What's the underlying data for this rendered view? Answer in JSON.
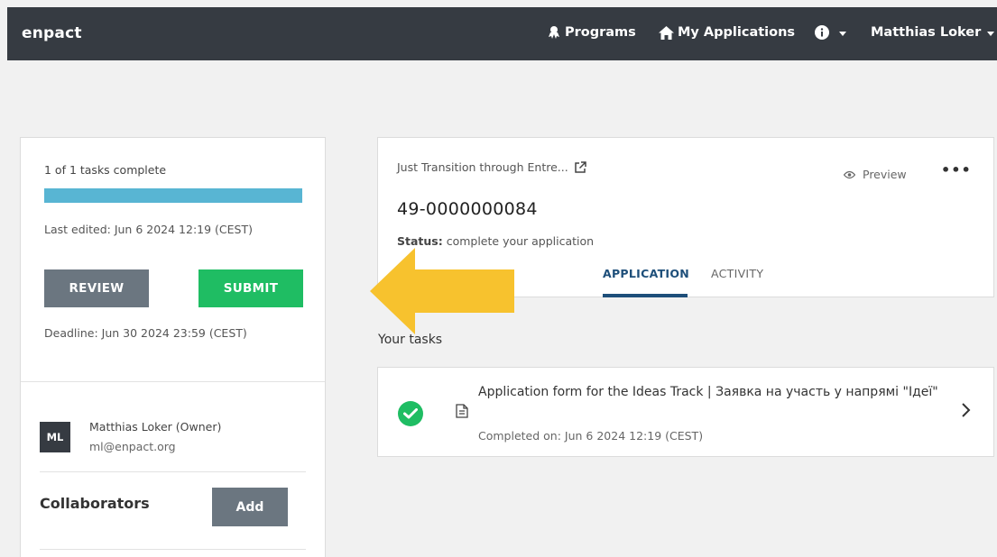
{
  "navbar": {
    "brand": "enpact",
    "programs": "Programs",
    "my_applications": "My Applications",
    "user": "Matthias Loker",
    "icons": {
      "programs": "award-icon",
      "apps": "home-icon",
      "info": "info-icon"
    }
  },
  "sidebar": {
    "tasks_complete": "1 of 1 tasks complete",
    "progress": 1.0,
    "last_edited": "Last edited: Jun 6 2024 12:19 (CEST)",
    "review_label": "REVIEW",
    "submit_label": "SUBMIT",
    "deadline": "Deadline: Jun 30 2024 23:59 (CEST)",
    "owner_initials": "ML",
    "owner_name": "Matthias Loker (Owner)",
    "owner_email": "ml@enpact.org",
    "collaborators_title": "Collaborators",
    "add_label": "Add"
  },
  "application": {
    "program_name": "Just Transition through Entre...",
    "preview_label": "Preview",
    "more_label": "•••",
    "id": "49-0000000084",
    "status_label": "Status:",
    "status_value": " complete your application",
    "tabs": [
      {
        "label": "APPLICATION",
        "active": true
      },
      {
        "label": "ACTIVITY",
        "active": false
      }
    ]
  },
  "tasks": {
    "heading": "Your tasks",
    "items": [
      {
        "title": "Application form for the Ideas Track | Заявка на участь у напрямі \"Ідеї\"",
        "completed": "Completed on: Jun 6 2024 12:19 (CEST)",
        "status": "complete"
      }
    ]
  },
  "colors": {
    "navbar": "#363b42",
    "progress": "#58b5d3",
    "submit": "#1fbd63",
    "secondary_button": "#6b7680",
    "active_tab": "#1e4f7a",
    "arrow": "#f7c22e"
  }
}
